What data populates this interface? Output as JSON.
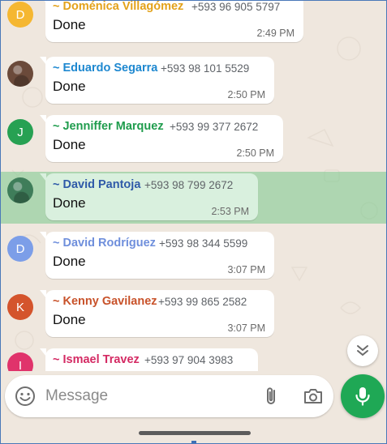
{
  "messages": [
    {
      "avatar_letter": "D",
      "avatar_color": "#f5b731",
      "sender": "~ Doménica Villagómez",
      "sender_color": "#e3a21a",
      "phone": "+593 96 905 5797",
      "text": "Done",
      "time": "2:49 PM"
    },
    {
      "avatar_letter": "",
      "avatar_color": "#6b4a3a",
      "sender": "~ Eduardo Segarra",
      "sender_color": "#1e88d0",
      "phone": "+593 98 101 5529",
      "text": "Done",
      "time": "2:50 PM"
    },
    {
      "avatar_letter": "J",
      "avatar_color": "#27a153",
      "sender": "~ Jenniffer Marquez",
      "sender_color": "#1f9c4d",
      "phone": "+593 99 377 2672",
      "text": "Done",
      "time": "2:50 PM"
    },
    {
      "avatar_letter": "",
      "avatar_color": "#3f7d5a",
      "sender": "~ David Pantoja",
      "sender_color": "#2f5aa8",
      "phone": "+593 98 799 2672",
      "text": "Done",
      "time": "2:53 PM",
      "selected": true
    },
    {
      "avatar_letter": "D",
      "avatar_color": "#7c9ee8",
      "sender": "~ David Rodríguez",
      "sender_color": "#6f8fdc",
      "phone": "+593 98 344 5599",
      "text": "Done",
      "time": "3:07 PM"
    },
    {
      "avatar_letter": "K",
      "avatar_color": "#d4542c",
      "sender": "~ Kenny Gavilanez",
      "sender_color": "#c8522a",
      "phone": "+593 99 865 2582",
      "text": "Done",
      "time": "3:07 PM"
    },
    {
      "avatar_letter": "I",
      "avatar_color": "#e0336b",
      "sender": "~ Ismael Travez",
      "sender_color": "#d42a63",
      "phone": "+593 97 904 3983",
      "text": "",
      "time": ""
    }
  ],
  "composer": {
    "placeholder": "Message"
  },
  "colors": {
    "accent": "#1fa855",
    "selection": "#8ccf9c"
  }
}
